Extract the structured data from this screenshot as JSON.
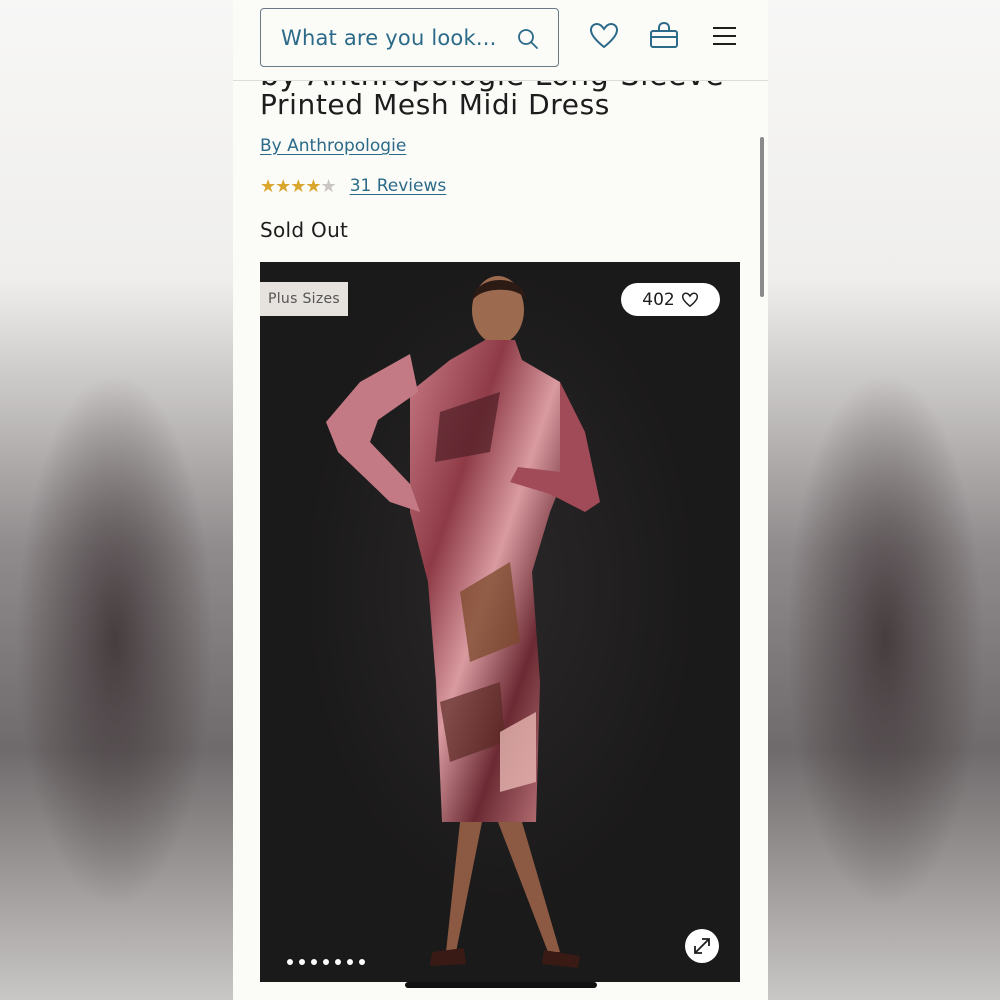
{
  "header": {
    "search_placeholder": "What are you look...",
    "icons": [
      "search-icon",
      "heart-icon",
      "bag-icon",
      "menu-icon"
    ]
  },
  "product": {
    "title_partial": "by Anthropologie Long-Sleeve",
    "title": "Printed Mesh Midi Dress",
    "brand": "By Anthropologie",
    "rating": {
      "stars_filled": 4.5,
      "stars_total": 5,
      "reviews_label": "31 Reviews"
    },
    "availability": "Sold Out"
  },
  "gallery": {
    "badge": "Plus Sizes",
    "likes": "402",
    "image_count": 7,
    "active_index": 0
  },
  "colors": {
    "accent": "#2b6a88",
    "star": "#d9a62e",
    "text": "#1d1d1d"
  }
}
